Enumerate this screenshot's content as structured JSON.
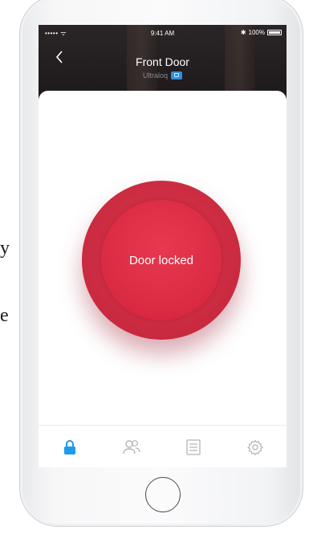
{
  "background_text": {
    "glyph_1": "y",
    "glyph_2": "e"
  },
  "status_bar": {
    "signal": "•••••  ᯤ",
    "time": "9:41 AM",
    "bluetooth": "✱",
    "battery_percent": "100%"
  },
  "header": {
    "back_icon": "chevron-left-icon",
    "title": "Front Door",
    "subtitle": "Ultraloq",
    "subtitle_icon": "lock-badge-icon"
  },
  "lock_control": {
    "status": "Door locked",
    "color": "#d92a41"
  },
  "tab_bar": {
    "tabs": [
      {
        "id": "lock",
        "icon": "lock-icon",
        "active": true
      },
      {
        "id": "users",
        "icon": "users-icon",
        "active": false
      },
      {
        "id": "history",
        "icon": "list-icon",
        "active": false
      },
      {
        "id": "settings",
        "icon": "gear-icon",
        "active": false
      }
    ],
    "active_color": "#1e9bea",
    "inactive_color": "#b4b4b8"
  }
}
